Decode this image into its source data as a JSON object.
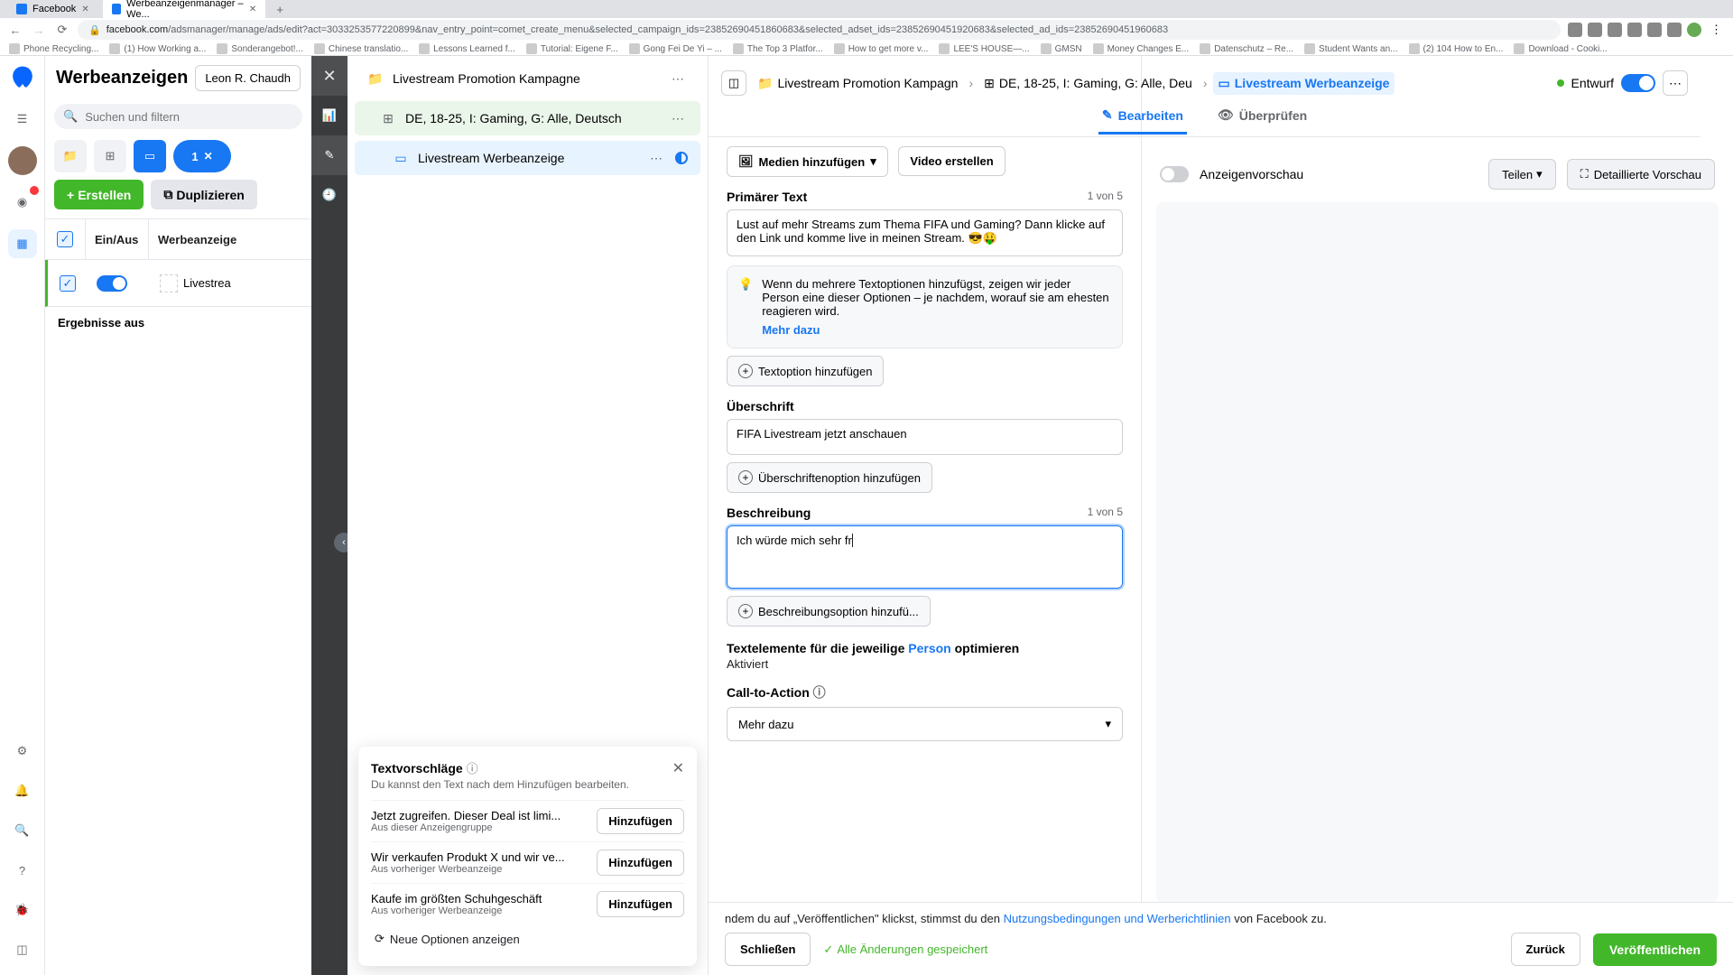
{
  "browser": {
    "tabs": [
      {
        "label": "Facebook"
      },
      {
        "label": "Werbeanzeigenmanager – We..."
      }
    ],
    "url_domain": "facebook.com",
    "url_path": "/adsmanager/manage/ads/edit?act=3033253577220899&nav_entry_point=comet_create_menu&selected_campaign_ids=23852690451860683&selected_adset_ids=23852690451920683&selected_ad_ids=23852690451960683",
    "bookmarks": [
      "Phone Recycling...",
      "(1) How Working a...",
      "Sonderangebot!...",
      "Chinese translatio...",
      "Lessons Learned f...",
      "Tutorial: Eigene F...",
      "Gong Fei De Yi – ...",
      "The Top 3 Platfor...",
      "How to get more v...",
      "LEE'S HOUSE—...",
      "GMSN",
      "Money Changes E...",
      "Datenschutz – Re...",
      "Student Wants an...",
      "(2) 104 How to En...",
      "Download - Cooki..."
    ]
  },
  "left_panel": {
    "title": "Werbeanzeigen",
    "account": "Leon R. Chaudh",
    "search_placeholder": "Suchen und filtern",
    "chip": "1",
    "create": "Erstellen",
    "duplicate": "Duplizieren",
    "col_toggle": "Ein/Aus",
    "col_ad": "Werbeanzeige",
    "row_name": "Livestrea",
    "results": "Ergebnisse aus"
  },
  "tree": {
    "campaign": "Livestream Promotion Kampagne",
    "adset": "DE, 18-25, I: Gaming, G: Alle, Deutsch",
    "ad": "Livestream Werbeanzeige"
  },
  "suggestions": {
    "title": "Textvorschläge",
    "subtitle": "Du kannst den Text nach dem Hinzufügen bearbeiten.",
    "items": [
      {
        "text": "Jetzt zugreifen. Dieser Deal ist limi...",
        "source": "Aus dieser Anzeigengruppe"
      },
      {
        "text": "Wir verkaufen Produkt X und wir ve...",
        "source": "Aus vorheriger Werbeanzeige"
      },
      {
        "text": "Kaufe im größten Schuhgeschäft",
        "source": "Aus vorheriger Werbeanzeige"
      }
    ],
    "add": "Hinzufügen",
    "more": "Neue Optionen anzeigen"
  },
  "crumbs": {
    "campaign": "Livestream Promotion Kampagn",
    "adset": "DE, 18-25, I: Gaming, G: Alle, Deu",
    "ad": "Livestream Werbeanzeige",
    "draft": "Entwurf"
  },
  "tabs": {
    "edit": "Bearbeiten",
    "review": "Überprüfen"
  },
  "form": {
    "add_media": "Medien hinzufügen",
    "create_video": "Video erstellen",
    "primary_label": "Primärer Text",
    "primary_counter": "1 von 5",
    "primary_value": "Lust auf mehr Streams zum Thema FIFA und Gaming? Dann klicke auf den Link und komme live in meinen Stream. 😎🤑",
    "info_text": "Wenn du mehrere Textoptionen hinzufügst, zeigen wir jeder Person eine dieser Optionen – je nachdem, worauf sie am ehesten reagieren wird.",
    "info_link": "Mehr dazu",
    "add_text_option": "Textoption hinzufügen",
    "headline_label": "Überschrift",
    "headline_value": "FIFA Livestream jetzt anschauen",
    "add_headline_option": "Überschriftenoption hinzufügen",
    "desc_label": "Beschreibung",
    "desc_counter": "1 von 5",
    "desc_value": "Ich würde mich sehr fr",
    "add_desc_option": "Beschreibungsoption hinzufü...",
    "optimize_pre": "Textelemente für die jeweilige ",
    "optimize_link": "Person",
    "optimize_post": " optimieren",
    "optimize_status": "Aktiviert",
    "cta_label": "Call-to-Action",
    "cta_value": "Mehr dazu"
  },
  "preview": {
    "label": "Anzeigenvorschau",
    "share": "Teilen",
    "detail": "Detaillierte Vorschau"
  },
  "footer": {
    "disclaimer_pre": "ndem du auf „Veröffentlichen\" klickst, stimmst du den ",
    "disclaimer_link": "Nutzungsbedingungen und Werberichtlinien",
    "disclaimer_post": " von Facebook zu.",
    "close": "Schließen",
    "saved": "Alle Änderungen gespeichert",
    "back": "Zurück",
    "publish": "Veröffentlichen"
  }
}
